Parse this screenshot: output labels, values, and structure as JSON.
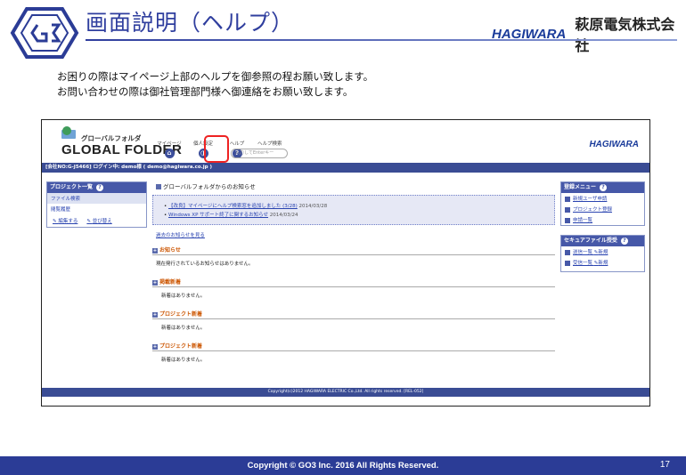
{
  "slide": {
    "title": "画面説明（ヘルプ）",
    "brand_logo": "HAGIWARA",
    "brand_name": "萩原電気株式会社",
    "intro_lines": [
      "お困りの際はマイページ上部のヘルプを御参照の程お願い致します。",
      "お問い合わせの際は御社管理部門様へ御連絡をお願い致します。"
    ],
    "copyright": "Copyright © GO3 Inc. 2016  All Rights Reserved.",
    "page_number": "17"
  },
  "app": {
    "logo_small": "グローバルフォルダ",
    "logo_big": "GLOBAL FOLDER",
    "nav": {
      "mypage": "マイページ",
      "settings": "個人設定",
      "help": "ヘルプ",
      "help_search_label": "ヘルプ検索",
      "help_search_placeholder": "入力してEnterキー"
    },
    "header_brand": "HAGIWARA",
    "login_bar": "[会社NO:G-J5466] ログイン中: demo様 ( demo@hagiwara.co.jp )",
    "left_panel": {
      "title": "プロジェクト一覧",
      "item_search": "ファイル検索",
      "item_history": "閲覧履歴",
      "action_edit": "編集する",
      "action_sort": "並び替え"
    },
    "center": {
      "title": "グローバルフォルダからのお知らせ",
      "news": [
        {
          "text": "【改良】マイページにヘルプ検索窓を追加しました (3/28)",
          "date": "2014/03/28"
        },
        {
          "text": "Windows XP サポート終了に関するお知らせ",
          "date": "2014/03/24"
        }
      ],
      "past_link": "過去のお知らせを見る",
      "sections": [
        {
          "title": "お知らせ",
          "text": "現在発行されているお知らせはありません。"
        },
        {
          "title": "掲載新着",
          "text": "新着はありません。"
        },
        {
          "title": "プロジェクト新着",
          "text": "新着はありません。"
        },
        {
          "title": "プロジェクト新着",
          "text": "新着はありません。"
        }
      ]
    },
    "right_menu": {
      "title": "登録メニュー",
      "items": [
        "新規ユーザ申請",
        "プロジェクト登録",
        "申請一覧"
      ]
    },
    "secure_panel": {
      "title": "セキュアファイル授受",
      "send": "送信一覧",
      "receive": "受信一覧",
      "new_label": "新規"
    },
    "footer": "Copyright(c)2012 HAGIWARA ELECTRIC Co.,Ltd. All rights reserved. [REL-052]"
  },
  "colors": {
    "accent": "#2b3c96",
    "highlight": "#ee2222",
    "link": "#2a44b0"
  }
}
